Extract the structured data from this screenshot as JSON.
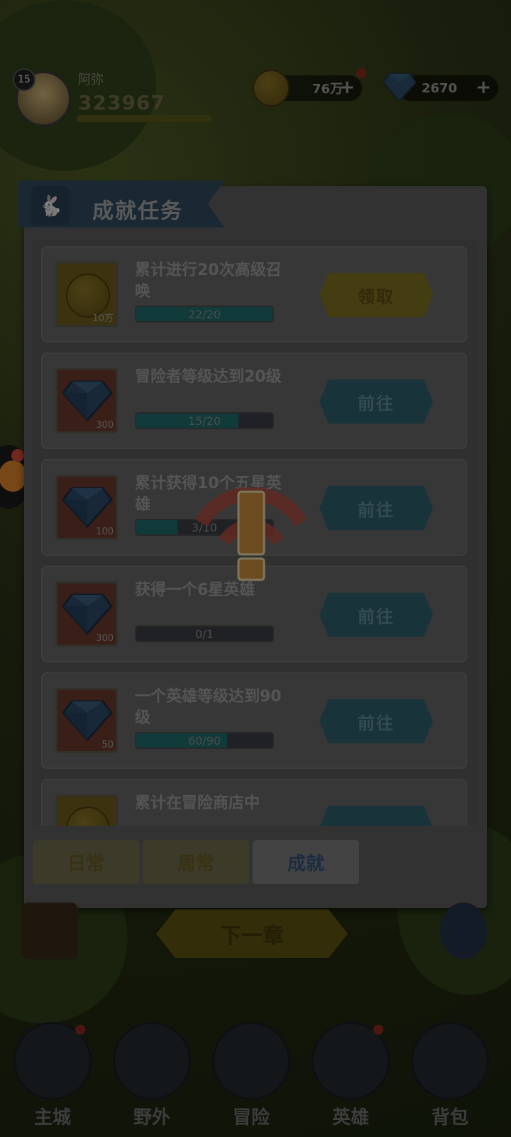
{
  "player": {
    "level": "15",
    "name": "阿弥",
    "power": "323967"
  },
  "resources": {
    "gold": "76万",
    "diamonds": "2670"
  },
  "modal": {
    "title": "成就任务",
    "tasks": [
      {
        "title": "累计进行20次高级召唤",
        "progress_text": "22/20",
        "progress": 1.0,
        "reward_type": "coin",
        "reward_amount": "10万",
        "button": "领取",
        "button_type": "claim"
      },
      {
        "title": "冒险者等级达到20级",
        "progress_text": "15/20",
        "progress": 0.75,
        "reward_type": "gem",
        "reward_amount": "300",
        "button": "前往",
        "button_type": "go"
      },
      {
        "title": "累计获得10个五星英雄",
        "progress_text": "3/10",
        "progress": 0.3,
        "reward_type": "gem",
        "reward_amount": "100",
        "button": "前往",
        "button_type": "go"
      },
      {
        "title": "获得一个6星英雄",
        "progress_text": "0/1",
        "progress": 0.0,
        "reward_type": "gem",
        "reward_amount": "300",
        "button": "前往",
        "button_type": "go"
      },
      {
        "title": "一个英雄等级达到90级",
        "progress_text": "60/90",
        "progress": 0.6667,
        "reward_type": "gem",
        "reward_amount": "50",
        "button": "前往",
        "button_type": "go"
      },
      {
        "title": "累计在冒险商店中",
        "progress_text": "",
        "progress": 0.0,
        "reward_type": "coin",
        "reward_amount": "",
        "button": "",
        "button_type": "go"
      }
    ],
    "tabs": [
      {
        "label": "日常",
        "active": false
      },
      {
        "label": "周常",
        "active": false
      },
      {
        "label": "成就",
        "active": true
      }
    ]
  },
  "next_chapter": "下一章",
  "bottom_nav": [
    {
      "label": "主城",
      "icon": "castle-icon",
      "badge": true
    },
    {
      "label": "野外",
      "icon": "map-scroll-icon",
      "badge": false
    },
    {
      "label": "冒险",
      "icon": "shield-emblem-icon",
      "badge": false
    },
    {
      "label": "英雄",
      "icon": "helmet-icon",
      "badge": true
    },
    {
      "label": "背包",
      "icon": "backpack-icon",
      "badge": false
    }
  ],
  "colors": {
    "overlay": "#000000",
    "progress_fill": "#1f6a6a",
    "claim_button": "#7a7020",
    "go_button": "#2f5e6a"
  }
}
